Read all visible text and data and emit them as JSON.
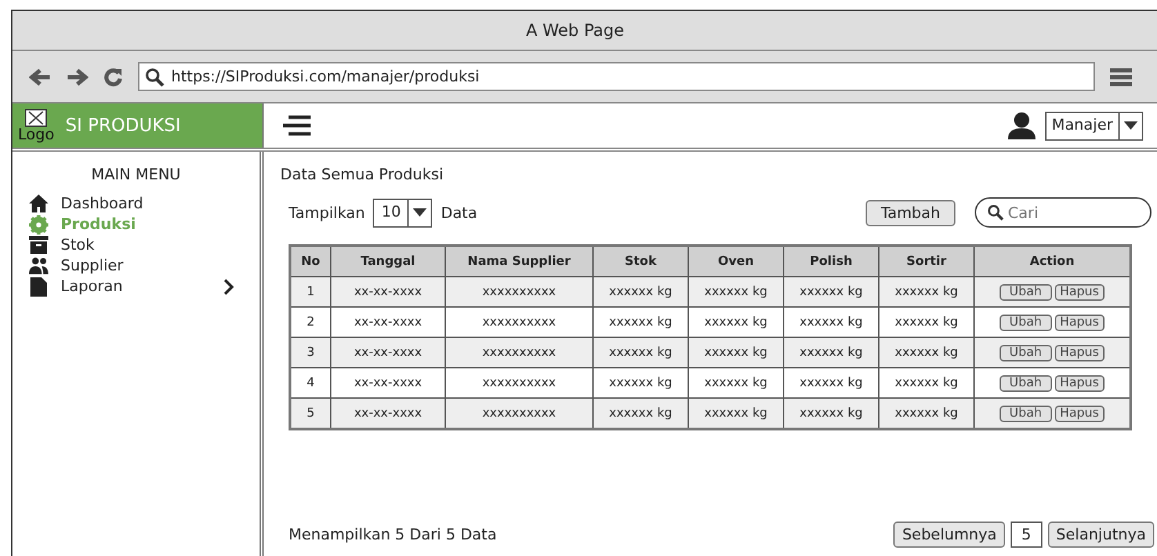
{
  "window": {
    "title": "A Web Page"
  },
  "browser": {
    "url": "https://SIProduksi.com/manajer/produksi"
  },
  "brand": {
    "logo_label": "Logo",
    "name": "SI PRODUKSI"
  },
  "user": {
    "role": "Manajer"
  },
  "sidebar": {
    "heading": "MAIN MENU",
    "items": [
      {
        "label": "Dashboard",
        "kind": "home",
        "selected": false,
        "has_submenu": false
      },
      {
        "label": "Produksi",
        "kind": "gear",
        "selected": true,
        "has_submenu": false
      },
      {
        "label": "Stok",
        "kind": "box",
        "selected": false,
        "has_submenu": false
      },
      {
        "label": "Supplier",
        "kind": "people",
        "selected": false,
        "has_submenu": false
      },
      {
        "label": "Laporan",
        "kind": "file",
        "selected": false,
        "has_submenu": true
      }
    ]
  },
  "content": {
    "title": "Data Semua Produksi",
    "show_label": "Tampilkan",
    "show_value": "10",
    "show_suffix": "Data",
    "add_button": "Tambah",
    "search": {
      "placeholder": "Cari"
    }
  },
  "table": {
    "columns": [
      "No",
      "Tanggal",
      "Nama Supplier",
      "Stok",
      "Oven",
      "Polish",
      "Sortir",
      "Action"
    ],
    "rows": [
      {
        "cells": [
          "1",
          "xx-xx-xxxx",
          "xxxxxxxxxx",
          "xxxxxx kg",
          "xxxxxx kg",
          "xxxxxx kg",
          "xxxxxx kg"
        ],
        "actions": [
          "Ubah",
          "Hapus"
        ]
      },
      {
        "cells": [
          "2",
          "xx-xx-xxxx",
          "xxxxxxxxxx",
          "xxxxxx kg",
          "xxxxxx kg",
          "xxxxxx kg",
          "xxxxxx kg"
        ],
        "actions": [
          "Ubah",
          "Hapus"
        ]
      },
      {
        "cells": [
          "3",
          "xx-xx-xxxx",
          "xxxxxxxxxx",
          "xxxxxx kg",
          "xxxxxx kg",
          "xxxxxx kg",
          "xxxxxx kg"
        ],
        "actions": [
          "Ubah",
          "Hapus"
        ]
      },
      {
        "cells": [
          "4",
          "xx-xx-xxxx",
          "xxxxxxxxxx",
          "xxxxxx kg",
          "xxxxxx kg",
          "xxxxxx kg",
          "xxxxxx kg"
        ],
        "actions": [
          "Ubah",
          "Hapus"
        ]
      },
      {
        "cells": [
          "5",
          "xx-xx-xxxx",
          "xxxxxxxxxx",
          "xxxxxx kg",
          "xxxxxx kg",
          "xxxxxx kg",
          "xxxxxx kg"
        ],
        "actions": [
          "Ubah",
          "Hapus"
        ]
      }
    ]
  },
  "footer": {
    "summary": "Menampilkan 5 Dari 5 Data",
    "prev": "Sebelumnya",
    "page": "5",
    "next": "Selanjutnya"
  }
}
